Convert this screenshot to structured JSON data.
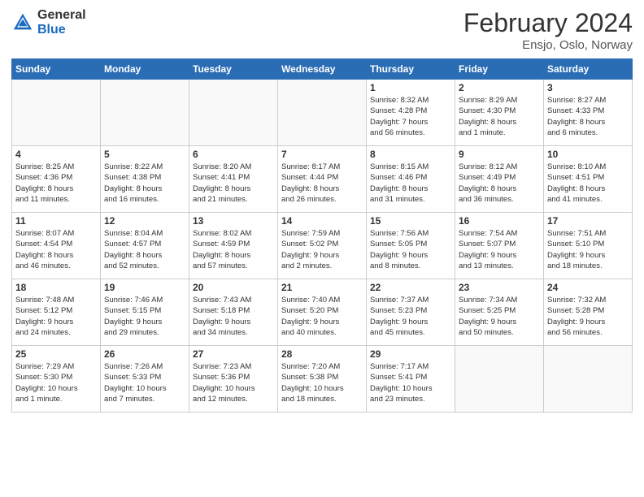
{
  "logo": {
    "general": "General",
    "blue": "Blue"
  },
  "header": {
    "month": "February 2024",
    "location": "Ensjo, Oslo, Norway"
  },
  "weekdays": [
    "Sunday",
    "Monday",
    "Tuesday",
    "Wednesday",
    "Thursday",
    "Friday",
    "Saturday"
  ],
  "days": [
    {
      "date": "",
      "info": ""
    },
    {
      "date": "",
      "info": ""
    },
    {
      "date": "",
      "info": ""
    },
    {
      "date": "",
      "info": ""
    },
    {
      "date": "1",
      "info": "Sunrise: 8:32 AM\nSunset: 4:28 PM\nDaylight: 7 hours\nand 56 minutes."
    },
    {
      "date": "2",
      "info": "Sunrise: 8:29 AM\nSunset: 4:30 PM\nDaylight: 8 hours\nand 1 minute."
    },
    {
      "date": "3",
      "info": "Sunrise: 8:27 AM\nSunset: 4:33 PM\nDaylight: 8 hours\nand 6 minutes."
    },
    {
      "date": "4",
      "info": "Sunrise: 8:25 AM\nSunset: 4:36 PM\nDaylight: 8 hours\nand 11 minutes."
    },
    {
      "date": "5",
      "info": "Sunrise: 8:22 AM\nSunset: 4:38 PM\nDaylight: 8 hours\nand 16 minutes."
    },
    {
      "date": "6",
      "info": "Sunrise: 8:20 AM\nSunset: 4:41 PM\nDaylight: 8 hours\nand 21 minutes."
    },
    {
      "date": "7",
      "info": "Sunrise: 8:17 AM\nSunset: 4:44 PM\nDaylight: 8 hours\nand 26 minutes."
    },
    {
      "date": "8",
      "info": "Sunrise: 8:15 AM\nSunset: 4:46 PM\nDaylight: 8 hours\nand 31 minutes."
    },
    {
      "date": "9",
      "info": "Sunrise: 8:12 AM\nSunset: 4:49 PM\nDaylight: 8 hours\nand 36 minutes."
    },
    {
      "date": "10",
      "info": "Sunrise: 8:10 AM\nSunset: 4:51 PM\nDaylight: 8 hours\nand 41 minutes."
    },
    {
      "date": "11",
      "info": "Sunrise: 8:07 AM\nSunset: 4:54 PM\nDaylight: 8 hours\nand 46 minutes."
    },
    {
      "date": "12",
      "info": "Sunrise: 8:04 AM\nSunset: 4:57 PM\nDaylight: 8 hours\nand 52 minutes."
    },
    {
      "date": "13",
      "info": "Sunrise: 8:02 AM\nSunset: 4:59 PM\nDaylight: 8 hours\nand 57 minutes."
    },
    {
      "date": "14",
      "info": "Sunrise: 7:59 AM\nSunset: 5:02 PM\nDaylight: 9 hours\nand 2 minutes."
    },
    {
      "date": "15",
      "info": "Sunrise: 7:56 AM\nSunset: 5:05 PM\nDaylight: 9 hours\nand 8 minutes."
    },
    {
      "date": "16",
      "info": "Sunrise: 7:54 AM\nSunset: 5:07 PM\nDaylight: 9 hours\nand 13 minutes."
    },
    {
      "date": "17",
      "info": "Sunrise: 7:51 AM\nSunset: 5:10 PM\nDaylight: 9 hours\nand 18 minutes."
    },
    {
      "date": "18",
      "info": "Sunrise: 7:48 AM\nSunset: 5:12 PM\nDaylight: 9 hours\nand 24 minutes."
    },
    {
      "date": "19",
      "info": "Sunrise: 7:46 AM\nSunset: 5:15 PM\nDaylight: 9 hours\nand 29 minutes."
    },
    {
      "date": "20",
      "info": "Sunrise: 7:43 AM\nSunset: 5:18 PM\nDaylight: 9 hours\nand 34 minutes."
    },
    {
      "date": "21",
      "info": "Sunrise: 7:40 AM\nSunset: 5:20 PM\nDaylight: 9 hours\nand 40 minutes."
    },
    {
      "date": "22",
      "info": "Sunrise: 7:37 AM\nSunset: 5:23 PM\nDaylight: 9 hours\nand 45 minutes."
    },
    {
      "date": "23",
      "info": "Sunrise: 7:34 AM\nSunset: 5:25 PM\nDaylight: 9 hours\nand 50 minutes."
    },
    {
      "date": "24",
      "info": "Sunrise: 7:32 AM\nSunset: 5:28 PM\nDaylight: 9 hours\nand 56 minutes."
    },
    {
      "date": "25",
      "info": "Sunrise: 7:29 AM\nSunset: 5:30 PM\nDaylight: 10 hours\nand 1 minute."
    },
    {
      "date": "26",
      "info": "Sunrise: 7:26 AM\nSunset: 5:33 PM\nDaylight: 10 hours\nand 7 minutes."
    },
    {
      "date": "27",
      "info": "Sunrise: 7:23 AM\nSunset: 5:36 PM\nDaylight: 10 hours\nand 12 minutes."
    },
    {
      "date": "28",
      "info": "Sunrise: 7:20 AM\nSunset: 5:38 PM\nDaylight: 10 hours\nand 18 minutes."
    },
    {
      "date": "29",
      "info": "Sunrise: 7:17 AM\nSunset: 5:41 PM\nDaylight: 10 hours\nand 23 minutes."
    },
    {
      "date": "",
      "info": ""
    },
    {
      "date": "",
      "info": ""
    }
  ]
}
